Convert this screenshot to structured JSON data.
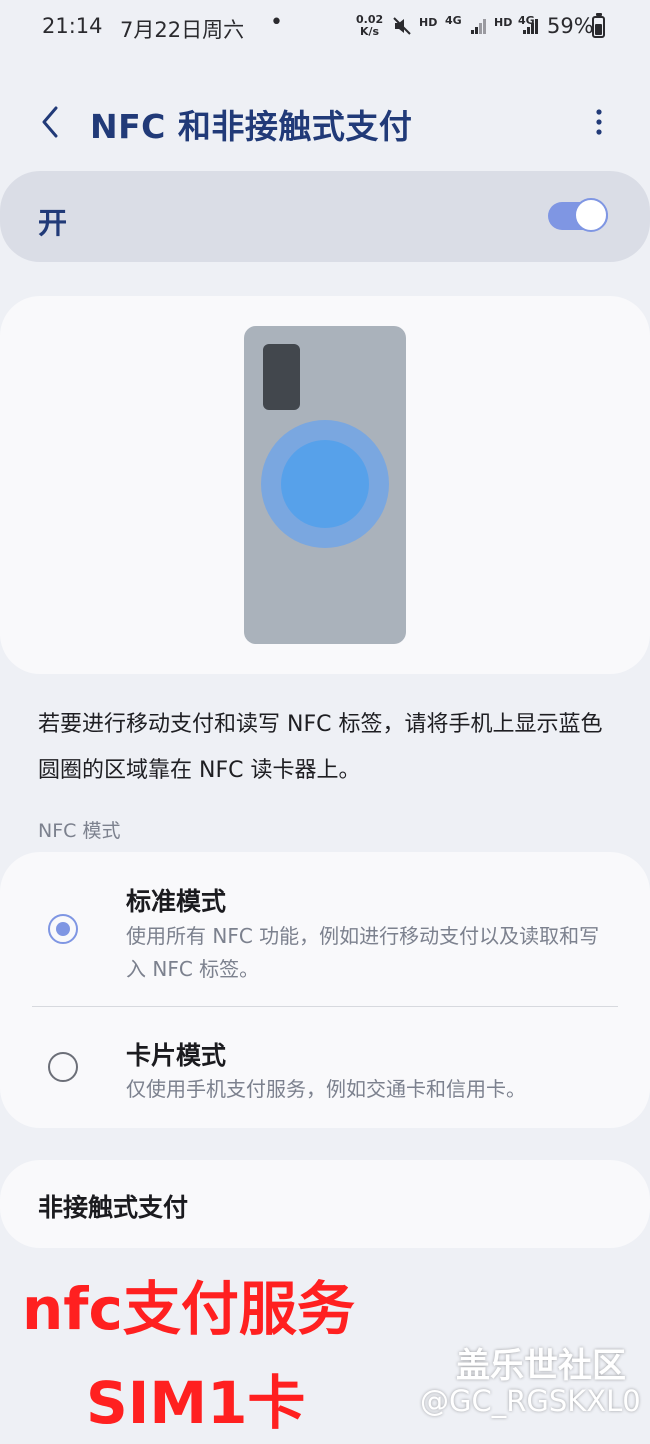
{
  "status_bar": {
    "time": "21:14",
    "date": "7月22日周六",
    "dot": "•",
    "speed_value": "0.02",
    "speed_unit": "K/s",
    "hd1": "HD",
    "net1": "4G",
    "hd2": "HD",
    "net2": "4G",
    "battery": "59%",
    "battery_level": 0.59
  },
  "header": {
    "title": "NFC 和非接触式支付"
  },
  "master_switch": {
    "label": "开",
    "on": true,
    "accent": "#7f96e3"
  },
  "description": "若要进行移动支付和读写 NFC 标签，请将手机上显示蓝色圆圈的区域靠在 NFC 读卡器上。",
  "nfc_mode": {
    "section_title": "NFC 模式",
    "options": [
      {
        "title": "标准模式",
        "subtitle": "使用所有 NFC 功能，例如进行移动支付以及读取和写入 NFC 标签。",
        "selected": true
      },
      {
        "title": "卡片模式",
        "subtitle": "仅使用手机支付服务，例如交通卡和信用卡。",
        "selected": false
      }
    ]
  },
  "contactless": {
    "label": "非接触式支付"
  },
  "overlay": {
    "line1": "nfc支付服务",
    "line2": "SIM1卡",
    "watermark_name": "盖乐世社区",
    "watermark_user": "@GC_RGSKXL0",
    "annotation_color": "#ff2020"
  }
}
